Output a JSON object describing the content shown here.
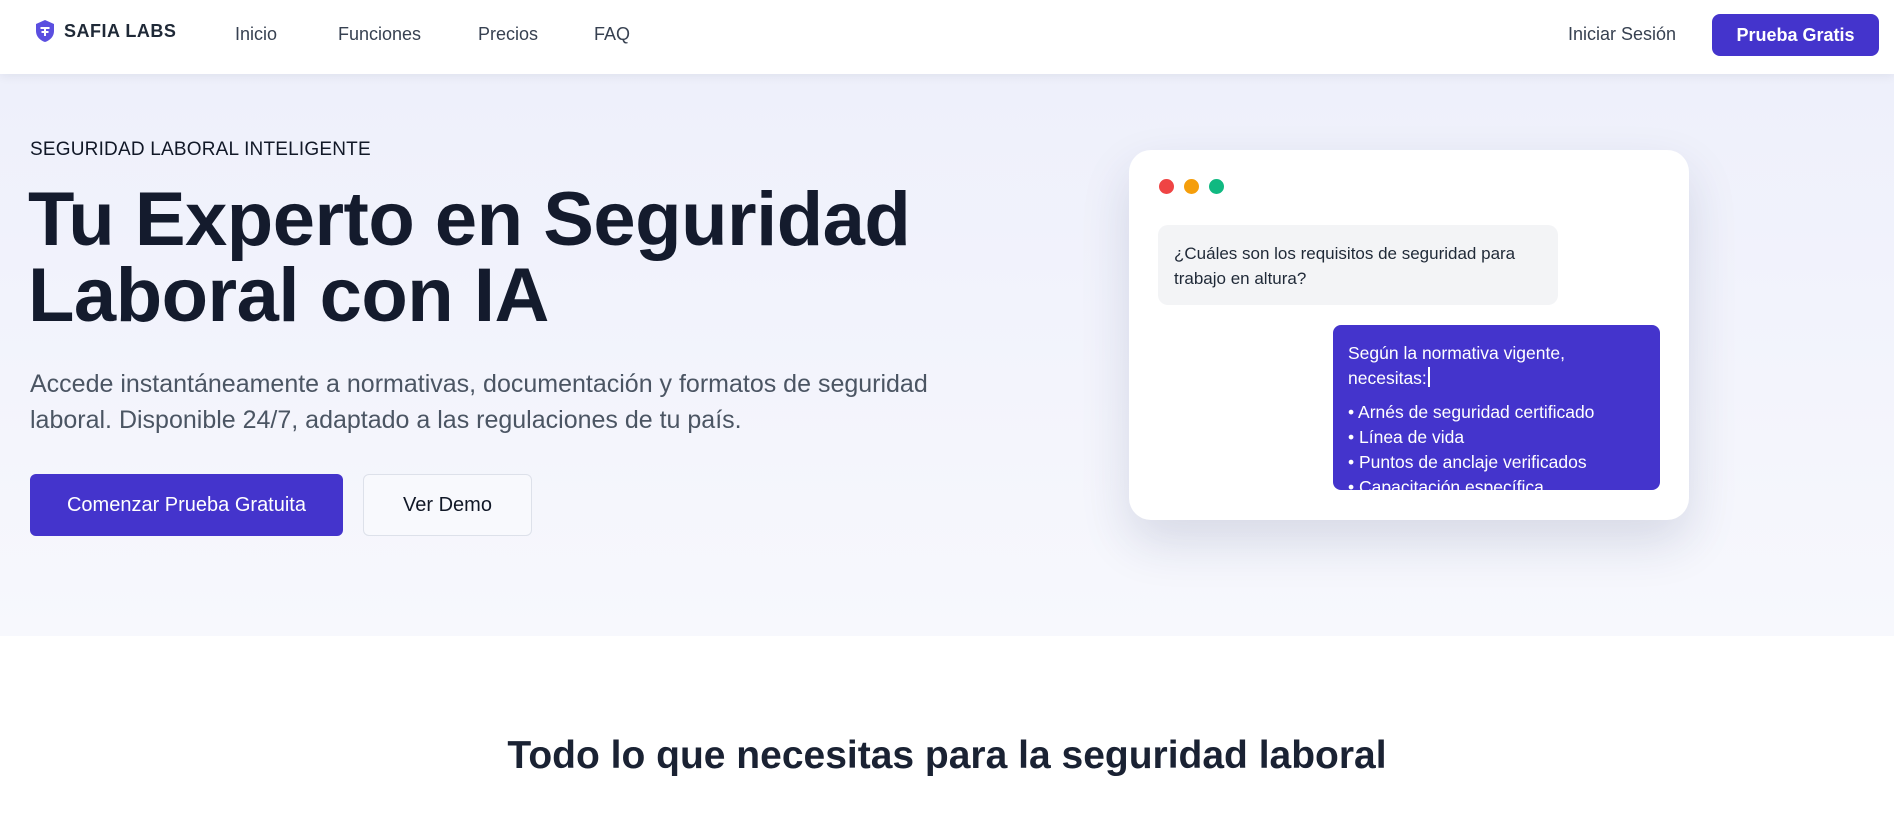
{
  "nav": {
    "brand": "SAFIA LABS",
    "links": [
      "Inicio",
      "Funciones",
      "Precios",
      "FAQ"
    ],
    "login": "Iniciar Sesión",
    "cta": "Prueba Gratis"
  },
  "hero": {
    "eyebrow": "SEGURIDAD LABORAL INTELIGENTE",
    "title_line1": "Tu Experto en Seguridad",
    "title_line2": "Laboral con IA",
    "subtitle_line1": "Accede instantáneamente a normativas, documentación y formatos de seguridad",
    "subtitle_line2": "laboral. Disponible 24/7, adaptado a las regulaciones de tu país.",
    "primary_button": "Comenzar Prueba Gratuita",
    "secondary_button": "Ver Demo"
  },
  "chat": {
    "window_dots": [
      "#ef4444",
      "#f59e0b",
      "#10b981"
    ],
    "user_message": "¿Cuáles son los requisitos de seguridad para trabajo en altura?",
    "ai_intro": "Según la normativa vigente, necesitas:",
    "ai_items": [
      "• Arnés de seguridad certificado",
      "• Línea de vida",
      "• Puntos de anclaje verificados",
      "• Capacitación específica"
    ]
  },
  "features": {
    "title": "Todo lo que necesitas para la seguridad laboral"
  },
  "colors": {
    "brand": "#4434cc",
    "heading": "#141b2d",
    "hero_bg": "#eef0fb"
  }
}
